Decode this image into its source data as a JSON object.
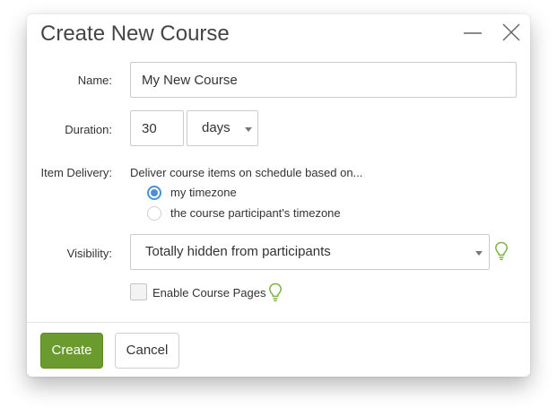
{
  "dialog": {
    "title": "Create New Course",
    "minimize_icon": "minimize-icon",
    "close_icon": "close-icon"
  },
  "form": {
    "name": {
      "label": "Name:",
      "value": "My New Course"
    },
    "duration": {
      "label": "Duration:",
      "value": "30",
      "unit": "days",
      "unit_options": [
        "days"
      ]
    },
    "item_delivery": {
      "label": "Item Delivery:",
      "hint": "Deliver course items on schedule based on...",
      "options": [
        {
          "label": "my timezone",
          "checked": true
        },
        {
          "label": "the course participant's timezone",
          "checked": false
        }
      ]
    },
    "visibility": {
      "label": "Visibility:",
      "value": "Totally hidden from participants",
      "help_icon": "lightbulb-icon"
    },
    "course_pages": {
      "label": "Enable Course Pages",
      "checked": false,
      "help_icon": "lightbulb-icon"
    }
  },
  "footer": {
    "create_label": "Create",
    "cancel_label": "Cancel"
  },
  "colors": {
    "primary_button": "#6b9a2e",
    "radio_accent": "#4a90d9",
    "help_icon": "#7cb342"
  }
}
